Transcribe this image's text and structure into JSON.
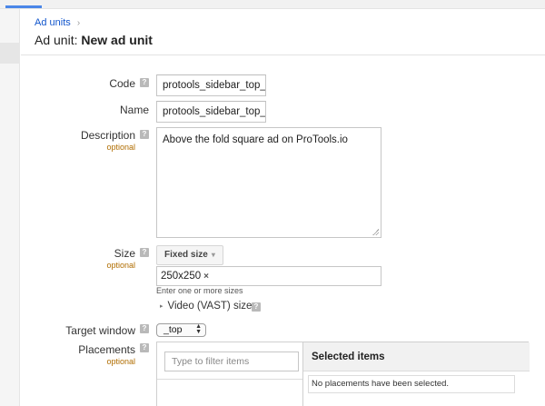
{
  "breadcrumb": {
    "link": "Ad units",
    "separator": "›"
  },
  "page_title": {
    "prefix": "Ad unit: ",
    "name": "New ad unit"
  },
  "help_glyph": "?",
  "form": {
    "code": {
      "label": "Code",
      "value": "protools_sidebar_top_sc"
    },
    "name": {
      "label": "Name",
      "value": "protools_sidebar_top_sc"
    },
    "description": {
      "label": "Description",
      "sub": "optional",
      "value": "Above the fold square ad on ProTools.io"
    },
    "size": {
      "label": "Size",
      "sub": "optional",
      "mode": "Fixed size",
      "mode_caret": "▾",
      "chips": [
        {
          "text": "250x250",
          "remove": "×"
        }
      ],
      "hint": "Enter one or more sizes",
      "video_toggle": "▸",
      "video_label": "Video (VAST) sizes"
    },
    "target_window": {
      "label": "Target window",
      "value": "_top",
      "arrows": "▲\n▼"
    },
    "placements": {
      "label": "Placements",
      "sub": "optional",
      "filter_placeholder": "Type to filter items",
      "selected_header": "Selected items",
      "empty_message": "No placements have been selected."
    }
  }
}
